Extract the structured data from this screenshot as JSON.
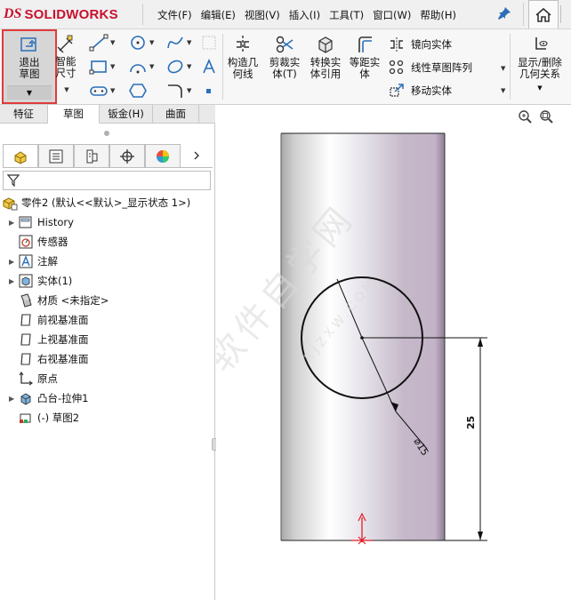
{
  "app": {
    "logo_prefix": "DS",
    "logo_text": "SOLIDWORKS"
  },
  "menu": [
    "文件(F)",
    "编辑(E)",
    "视图(V)",
    "插入(I)",
    "工具(T)",
    "窗口(W)",
    "帮助(H)"
  ],
  "ribbon": {
    "exit_sketch": "退出草图",
    "smart_dim": "智能尺寸",
    "construct": "构造几何线",
    "trim": "剪裁实体(T)",
    "convert": "转换实体引用",
    "offset": "等距实体",
    "mirror": "镜向实体",
    "linear_pattern": "线性草图阵列",
    "move": "移动实体",
    "relations": "显示/删除几何关系"
  },
  "tabs": [
    "特征",
    "草图",
    "钣金(H)",
    "曲面(E)"
  ],
  "active_tab": 1,
  "tree": {
    "root": "零件2 (默认<<默认>_显示状态 1>)",
    "items": [
      {
        "label": "History",
        "expandable": true,
        "icon": "history-icon"
      },
      {
        "label": "传感器",
        "expandable": false,
        "icon": "sensor-icon"
      },
      {
        "label": "注解",
        "expandable": true,
        "icon": "annotation-icon"
      },
      {
        "label": "实体(1)",
        "expandable": true,
        "icon": "solid-body-icon"
      },
      {
        "label": "材质 <未指定>",
        "expandable": false,
        "icon": "material-icon"
      },
      {
        "label": "前视基准面",
        "expandable": false,
        "icon": "plane-icon"
      },
      {
        "label": "上视基准面",
        "expandable": false,
        "icon": "plane-icon"
      },
      {
        "label": "右视基准面",
        "expandable": false,
        "icon": "plane-icon"
      },
      {
        "label": "原点",
        "expandable": false,
        "icon": "origin-icon"
      },
      {
        "label": "凸台-拉伸1",
        "expandable": true,
        "icon": "extrude-icon"
      },
      {
        "label": "(-) 草图2",
        "expandable": false,
        "icon": "sketch-icon"
      }
    ]
  },
  "drawing": {
    "diameter_label": "⌀15",
    "height_label": "25"
  },
  "watermark": {
    "cn": "软件自学网",
    "url": "RJZXW.COM"
  },
  "colors": {
    "accent": "#c8102e",
    "highlight_border": "#e03a3a",
    "icon_blue": "#2a6fb8"
  }
}
